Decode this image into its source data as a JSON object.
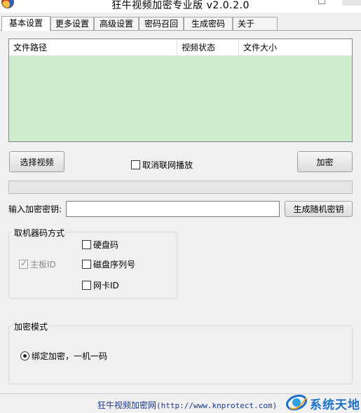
{
  "window": {
    "title": "狂牛视频加密专业版 v2.0.2.0"
  },
  "tabs": [
    {
      "label": "基本设置",
      "active": true
    },
    {
      "label": "更多设置",
      "active": false
    },
    {
      "label": "高级设置",
      "active": false
    },
    {
      "label": "密码召回",
      "active": false
    },
    {
      "label": "生成密码",
      "active": false
    },
    {
      "label": "关于",
      "active": false
    }
  ],
  "file_list": {
    "columns": [
      "文件路径",
      "视频状态",
      "文件大小"
    ],
    "rows": [],
    "background": "#cdeccb"
  },
  "actions": {
    "select_video": "选择视频",
    "cancel_network_play": "取消联网播放",
    "cancel_network_play_checked": false,
    "encrypt": "加密"
  },
  "progress": {
    "value": 0
  },
  "key": {
    "label": "输入加密密钥:",
    "value": "",
    "generate_button": "生成随机密钥"
  },
  "machine_code": {
    "title": "取机器码方式",
    "options": [
      {
        "label": "主板ID",
        "checked": true,
        "disabled": true
      },
      {
        "label": "硬盘码",
        "checked": false,
        "disabled": false
      },
      {
        "label": "磁盘序列号",
        "checked": false,
        "disabled": false
      },
      {
        "label": "网卡ID",
        "checked": false,
        "disabled": false
      }
    ]
  },
  "encrypt_mode": {
    "title": "加密模式",
    "option": "绑定加密，一机一码",
    "selected": true
  },
  "footer": {
    "name": "狂牛视频加密网",
    "url": "(http://www.knprotect.com)"
  },
  "watermark": {
    "text": "系统天地"
  },
  "colors": {
    "list_bg": "#cdeccb",
    "footer_text": "#1a3a8a",
    "watermark": "#1a6fc8"
  }
}
